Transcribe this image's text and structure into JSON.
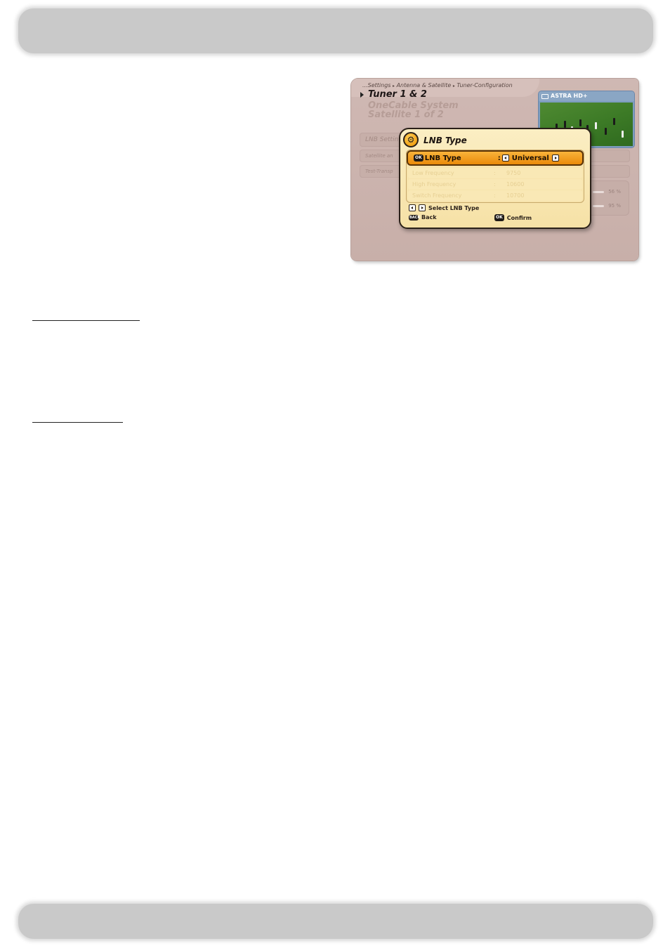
{
  "screen": {
    "breadcrumb": [
      "...Settings",
      "Antenna & Satellite",
      "Tuner-Configuration"
    ],
    "title": "Tuner 1 & 2",
    "subtitle_1": "OneCable System",
    "subtitle_2": "Satellite 1 of 2",
    "menu": [
      "LNB Settin",
      "Satellite an",
      "Test-Transp"
    ],
    "signal": [
      {
        "value": "56 %"
      },
      {
        "value": "95 %"
      }
    ],
    "preview": {
      "channel": "ASTRA HD+"
    }
  },
  "dialog": {
    "title": "LNB Type",
    "selected_row": {
      "key": "OK",
      "label": "LNB Type",
      "colon": ":",
      "value": "Universal"
    },
    "rows": [
      {
        "label": "Low Frequency",
        "colon": ":",
        "value": "9750"
      },
      {
        "label": "High Frequency",
        "colon": ":",
        "value": "10600"
      },
      {
        "label": "Switch Frequency",
        "colon": ":",
        "value": "10700"
      }
    ],
    "legend": {
      "select": "Select LNB Type",
      "back_key": "BACK",
      "back": "Back",
      "confirm_key": "OK",
      "confirm": "Confirm"
    }
  },
  "colors": {
    "accent": "#ea8a0a",
    "panel": "#c8afa9",
    "dialog_bg": "#f6e1a6"
  }
}
